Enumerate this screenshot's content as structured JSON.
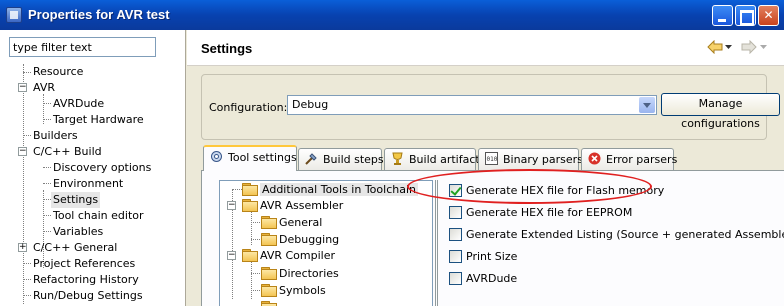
{
  "window": {
    "title": "Properties for AVR test",
    "controls": [
      "minimize",
      "maximize",
      "close"
    ]
  },
  "left": {
    "filter_value": "type filter text",
    "tree": [
      {
        "label": "Resource",
        "depth": 0,
        "expander": ""
      },
      {
        "label": "AVR",
        "depth": 0,
        "expander": "-"
      },
      {
        "label": "AVRDude",
        "depth": 1,
        "expander": ""
      },
      {
        "label": "Target Hardware",
        "depth": 1,
        "expander": ""
      },
      {
        "label": "Builders",
        "depth": 0,
        "expander": ""
      },
      {
        "label": "C/C++ Build",
        "depth": 0,
        "expander": "-"
      },
      {
        "label": "Discovery options",
        "depth": 1,
        "expander": ""
      },
      {
        "label": "Environment",
        "depth": 1,
        "expander": ""
      },
      {
        "label": "Settings",
        "depth": 1,
        "expander": "",
        "selected": true
      },
      {
        "label": "Tool chain editor",
        "depth": 1,
        "expander": ""
      },
      {
        "label": "Variables",
        "depth": 1,
        "expander": ""
      },
      {
        "label": "C/C++ General",
        "depth": 0,
        "expander": "+"
      },
      {
        "label": "Project References",
        "depth": 0,
        "expander": ""
      },
      {
        "label": "Refactoring History",
        "depth": 0,
        "expander": ""
      },
      {
        "label": "Run/Debug Settings",
        "depth": 0,
        "expander": ""
      }
    ]
  },
  "header": {
    "title": "Settings"
  },
  "config": {
    "label": "Configuration:",
    "value": "Debug",
    "manage_label": "Manage configurations"
  },
  "tabs": [
    {
      "label": "Tool settings",
      "icon": "tool-settings-icon",
      "active": true
    },
    {
      "label": "Build steps",
      "icon": "build-steps-icon"
    },
    {
      "label": "Build artifact",
      "icon": "build-artifact-icon"
    },
    {
      "label": "Binary parsers",
      "icon": "binary-parsers-icon"
    },
    {
      "label": "Error parsers",
      "icon": "error-parsers-icon"
    }
  ],
  "tool_tree": [
    {
      "label": "Additional Tools in Toolchain",
      "depth": 0,
      "expander": "",
      "selected": true
    },
    {
      "label": "AVR Assembler",
      "depth": 0,
      "expander": "-"
    },
    {
      "label": "General",
      "depth": 1,
      "expander": ""
    },
    {
      "label": "Debugging",
      "depth": 1,
      "expander": ""
    },
    {
      "label": "AVR Compiler",
      "depth": 0,
      "expander": "-"
    },
    {
      "label": "Directories",
      "depth": 1,
      "expander": ""
    },
    {
      "label": "Symbols",
      "depth": 1,
      "expander": ""
    }
  ],
  "options": [
    {
      "label": "Generate HEX file for Flash memory",
      "checked": true
    },
    {
      "label": "Generate HEX file for EEPROM",
      "checked": false
    },
    {
      "label": "Generate Extended Listing (Source + generated Assembler)",
      "checked": false
    },
    {
      "label": "Print Size",
      "checked": false
    },
    {
      "label": "AVRDude",
      "checked": false
    }
  ],
  "colors": {
    "titlebar": "#0a5fd8",
    "tab_active_accent": "#ffc83c",
    "highlight_ellipse": "#e02020",
    "selection": "#e6e6e6"
  }
}
